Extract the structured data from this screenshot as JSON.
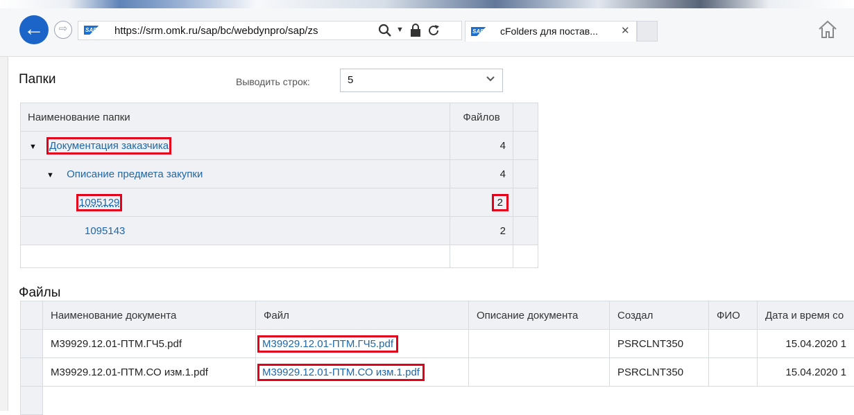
{
  "browser": {
    "url": "https://srm.omk.ru/sap/bc/webdynpro/sap/zs",
    "tab_title": "cFolders для постав...",
    "back_symbol": "←",
    "forward_symbol": "⇨",
    "logo_text": "SAP"
  },
  "folders": {
    "title": "Папки",
    "rows_label": "Выводить строк:",
    "rows_value": "5",
    "columns": [
      "Наименование папки",
      "Файлов"
    ],
    "rows": [
      {
        "name": "Документация заказчика",
        "count": "4",
        "level": 0,
        "expanded": true
      },
      {
        "name": "Описание предмета закупки",
        "count": "4",
        "level": 1,
        "expanded": true
      },
      {
        "name": "1095129",
        "count": "2",
        "level": 2,
        "expanded": false
      },
      {
        "name": "1095143",
        "count": "2",
        "level": 2,
        "expanded": false
      }
    ]
  },
  "files": {
    "title": "Файлы",
    "columns": [
      "Наименование документа",
      "Файл",
      "Описание документа",
      "Создал",
      "ФИО",
      "Дата и время со"
    ],
    "rows": [
      {
        "doc": "M39929.12.01-ПТМ.ГЧ5.pdf",
        "file": "M39929.12.01-ПТМ.ГЧ5.pdf",
        "desc": "",
        "author": "PSRCLNT350",
        "fio": "",
        "date": "15.04.2020 1"
      },
      {
        "doc": "M39929.12.01-ПТМ.СО изм.1.pdf",
        "file": "M39929.12.01-ПТМ.СО изм.1.pdf",
        "desc": "",
        "author": "PSRCLNT350",
        "fio": "",
        "date": "15.04.2020 1"
      }
    ]
  },
  "colors": {
    "link": "#1f67a8",
    "highlight": "#e3001b",
    "header_bg": "#eff1f4"
  }
}
